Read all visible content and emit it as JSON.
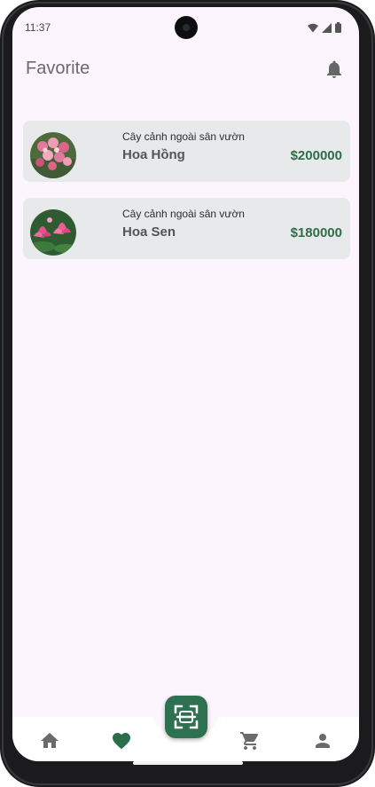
{
  "status_bar": {
    "time": "11:37"
  },
  "app_bar": {
    "title": "Favorite"
  },
  "favorites": [
    {
      "category": "Cây cảnh ngoài sân vườn",
      "name": "Hoa Hồng",
      "price": "$200000"
    },
    {
      "category": "Cây cảnh ngoài sân vườn",
      "name": "Hoa Sen",
      "price": "$180000"
    }
  ],
  "bottom_nav": {
    "items": [
      "home-icon",
      "heart-icon",
      "scan-icon",
      "cart-icon",
      "person-icon"
    ],
    "active": "heart-icon"
  },
  "colors": {
    "accent": "#2e7151",
    "price": "#2c6e49",
    "background": "#fdf5fd",
    "card": "#e8e9eb"
  }
}
